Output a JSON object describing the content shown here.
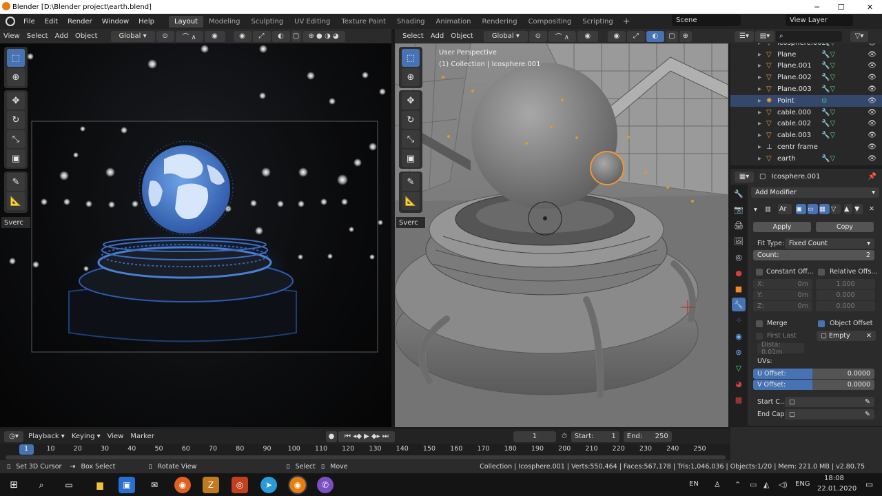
{
  "window": {
    "title": "Blender [D:\\Blender project\\earth.blend]",
    "min_icon": "─",
    "max_icon": "☐",
    "close_icon": "✕"
  },
  "menu": {
    "file": "File",
    "edit": "Edit",
    "render": "Render",
    "window": "Window",
    "help": "Help"
  },
  "workspaces": [
    "Layout",
    "Modeling",
    "Sculpting",
    "UV Editing",
    "Texture Paint",
    "Shading",
    "Animation",
    "Rendering",
    "Compositing",
    "Scripting"
  ],
  "scene": "Scene",
  "view_layer": "View Layer",
  "left_header": {
    "view": "View",
    "select": "Select",
    "add": "Add",
    "object": "Object",
    "orientation": "Global"
  },
  "right_header": {
    "select": "Select",
    "add": "Add",
    "object": "Object",
    "orientation": "Global"
  },
  "right_overlay": {
    "perspective": "User Perspective",
    "collection": "(1) Collection | Icosphere.001"
  },
  "sverc_label": "Sverc",
  "outliner": {
    "rows": [
      {
        "name": "Icosphere.002",
        "icon": "mesh",
        "sel": false
      },
      {
        "name": "Plane",
        "icon": "mesh",
        "sel": false
      },
      {
        "name": "Plane.001",
        "icon": "mesh",
        "sel": false
      },
      {
        "name": "Plane.002",
        "icon": "mesh",
        "sel": false
      },
      {
        "name": "Plane.003",
        "icon": "mesh",
        "sel": false
      },
      {
        "name": "Point",
        "icon": "light",
        "sel": true
      },
      {
        "name": "cable.000",
        "icon": "mesh",
        "sel": false
      },
      {
        "name": "cable.002",
        "icon": "mesh",
        "sel": false
      },
      {
        "name": "cable.003",
        "icon": "mesh",
        "sel": false
      },
      {
        "name": "centr frame",
        "icon": "empty",
        "sel": false
      },
      {
        "name": "earth",
        "icon": "mesh",
        "sel": false
      }
    ]
  },
  "properties": {
    "object_name": "Icosphere.001",
    "add_modifier": "Add Modifier",
    "modifier_short": "Ar",
    "apply": "Apply",
    "copy": "Copy",
    "fit_type_label": "Fit Type:",
    "fit_type_value": "Fixed Count",
    "count_label": "Count:",
    "count_value": "2",
    "constant_offset": "Constant Off...",
    "relative_offset": "Relative Offs...",
    "x_label": "X:",
    "y_label": "Y:",
    "z_label": "Z:",
    "const_x": "0m",
    "const_y": "0m",
    "const_z": "0m",
    "rel_x": "1.000",
    "rel_y": "0.000",
    "rel_z": "0.000",
    "merge": "Merge",
    "object_offset": "Object Offset",
    "first_last": "First Last",
    "empty": "Empty",
    "distance": "Dista:  0.01m",
    "uvs": "UVs:",
    "u_offset_label": "U Offset:",
    "u_offset_value": "0.0000",
    "v_offset_label": "V Offset:",
    "v_offset_value": "0.0000",
    "start_cap": "Start C...",
    "end_cap": "End Cap:"
  },
  "timeline": {
    "playback": "Playback",
    "keying": "Keying",
    "view": "View",
    "marker": "Marker",
    "current_frame": "1",
    "start_label": "Start:",
    "start": "1",
    "end_label": "End:",
    "end": "250",
    "ticks": [
      "1",
      "10",
      "20",
      "30",
      "40",
      "50",
      "60",
      "70",
      "80",
      "90",
      "100",
      "110",
      "120",
      "130",
      "140",
      "150",
      "160",
      "170",
      "180",
      "190",
      "200",
      "210",
      "220",
      "230",
      "240",
      "250"
    ]
  },
  "status": {
    "set_cursor": "Set 3D Cursor",
    "box_select": "Box Select",
    "rotate_view": "Rotate View",
    "select": "Select",
    "move": "Move",
    "stats": "Collection | Icosphere.001 | Verts:550,464 | Faces:567,178 | Tris:1,046,036 | Objects:1/20 | Mem: 221.0 MB | v2.80.75"
  },
  "taskbar": {
    "lang1": "EN",
    "lang2": "ENG",
    "time": "18:08",
    "date": "22.01.2020"
  }
}
